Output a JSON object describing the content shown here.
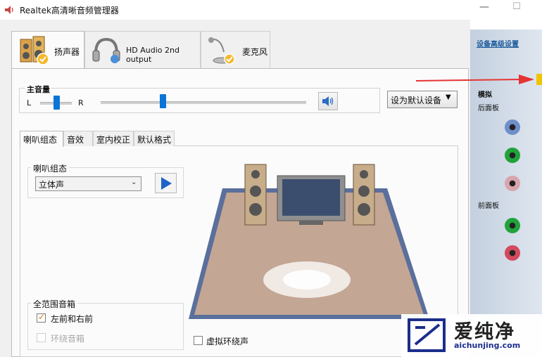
{
  "window": {
    "title": "Realtek高清晰音频管理器",
    "min_icon": "—",
    "max_icon": "☐"
  },
  "device_tabs": [
    {
      "label": "扬声器",
      "icon": "speaker-icon"
    },
    {
      "label": "HD Audio 2nd output",
      "icon": "headphones-icon"
    },
    {
      "label": "麦克风",
      "icon": "microphone-icon"
    }
  ],
  "main_volume": {
    "label": "主音量",
    "balance_left": "L",
    "balance_right": "R",
    "balance_level": 0.5,
    "volume_level": 0.3
  },
  "set_default": {
    "label": "设为默认设备",
    "caret": "▼"
  },
  "sub_tabs": [
    "喇叭组态",
    "音效",
    "室内校正",
    "默认格式"
  ],
  "speaker_config": {
    "group_label": "喇叭组态",
    "selected": "立体声",
    "caret": "⌄"
  },
  "full_range": {
    "group_label": "全范围音箱",
    "front": {
      "label": "左前和右前",
      "checked": true,
      "mark": "✓"
    },
    "surround": {
      "label": "环绕音箱",
      "checked": false,
      "enabled": false
    }
  },
  "virtual_surround": {
    "label": "虚拟环绕声",
    "checked": false
  },
  "sidebar": {
    "advanced_link": "设备高级设置",
    "analog": "模拟",
    "rear_panel": "后面板",
    "front_panel": "前面板",
    "rear_jacks": [
      "#6f8fc8",
      "#22a33a",
      "#d9a4ad"
    ],
    "front_jacks": [
      "#22a33a",
      "#d24a5c"
    ]
  },
  "watermark": {
    "text": "爱纯净",
    "url": "aichunjing.com"
  },
  "colors": {
    "accent": "#0a74d8",
    "arrow": "#e53434",
    "floor": "#c3a693"
  }
}
